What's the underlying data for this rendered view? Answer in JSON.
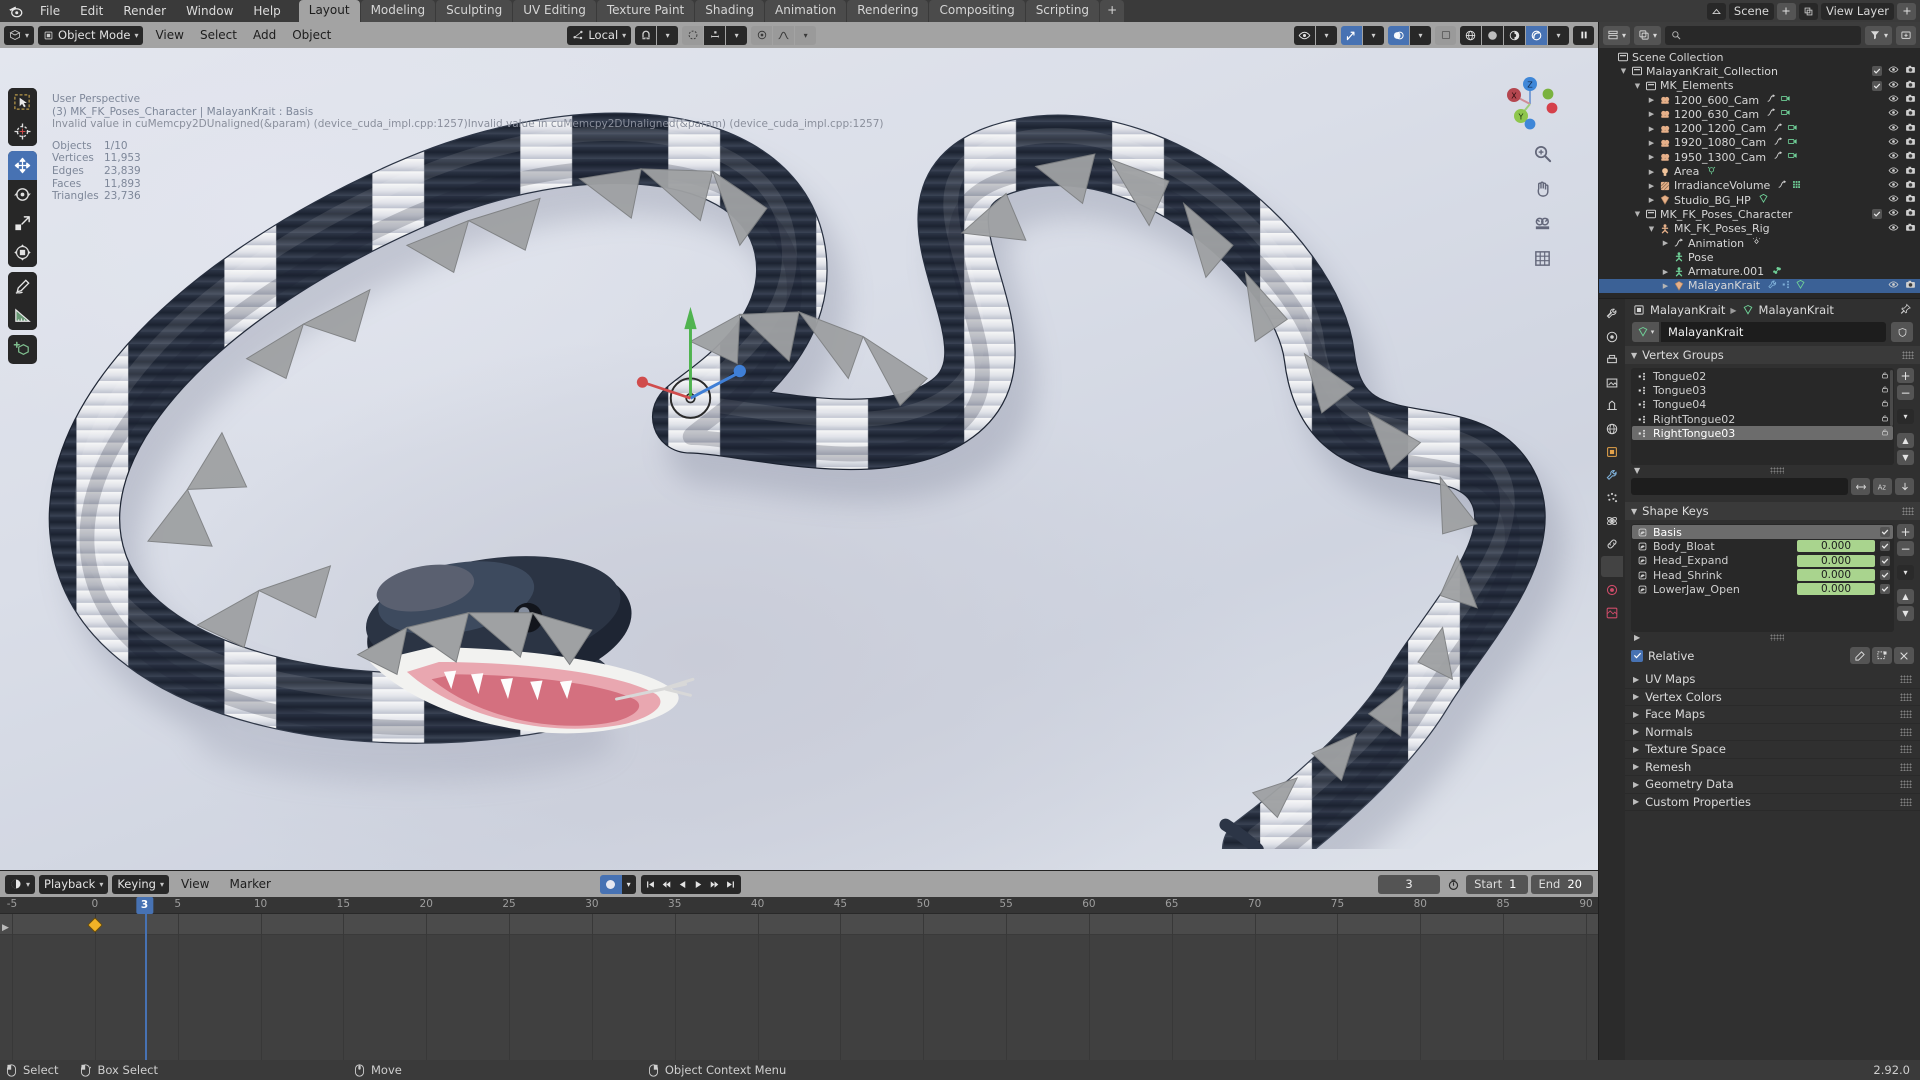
{
  "app": {
    "version": "2.92.0"
  },
  "topbar": {
    "logo_icon": "blender-logo-icon",
    "menus": [
      "File",
      "Edit",
      "Render",
      "Window",
      "Help"
    ],
    "workspaces": [
      {
        "label": "Layout",
        "active": true
      },
      {
        "label": "Modeling",
        "active": false
      },
      {
        "label": "Sculpting",
        "active": false
      },
      {
        "label": "UV Editing",
        "active": false
      },
      {
        "label": "Texture Paint",
        "active": false
      },
      {
        "label": "Shading",
        "active": false
      },
      {
        "label": "Animation",
        "active": false
      },
      {
        "label": "Rendering",
        "active": false
      },
      {
        "label": "Compositing",
        "active": false
      },
      {
        "label": "Scripting",
        "active": false
      }
    ],
    "add_workspace_label": "+",
    "scene_label": "Scene",
    "view_layer_label": "View Layer"
  },
  "viewport_header": {
    "mode": "Object Mode",
    "menus": [
      "View",
      "Select",
      "Add",
      "Object"
    ],
    "transform_orientation": "Local",
    "snap_icon": "magnet-icon",
    "proportional_icon": "proportional-edit-icon",
    "shading_modes": [
      "wireframe",
      "solid",
      "material-preview",
      "rendered"
    ],
    "active_shading": "rendered"
  },
  "viewport_overlay": {
    "perspective": "User Perspective",
    "context": "(3) MK_FK_Poses_Character | MalayanKrait : Basis",
    "error": "Invalid value in cuMemcpy2DUnaligned(&param) (device_cuda_impl.cpp:1257)Invalid value in cuMemcpy2DUnaligned(&param) (device_cuda_impl.cpp:1257)",
    "stats": [
      {
        "label": "Objects",
        "value": "1/10"
      },
      {
        "label": "Vertices",
        "value": "11,953"
      },
      {
        "label": "Edges",
        "value": "23,839"
      },
      {
        "label": "Faces",
        "value": "11,893"
      },
      {
        "label": "Triangles",
        "value": "23,736"
      }
    ],
    "gizmo_axes": [
      "X",
      "Y",
      "Z"
    ]
  },
  "toolbar": {
    "tools": [
      {
        "name": "tweak-tool",
        "icon": "cursor-arrow-icon",
        "active": false
      },
      {
        "name": "cursor-tool",
        "icon": "3d-cursor-icon",
        "active": false
      },
      {
        "name": "move-tool",
        "icon": "move-arrows-icon",
        "active": true
      },
      {
        "name": "rotate-tool",
        "icon": "rotate-icon",
        "active": false
      },
      {
        "name": "scale-tool",
        "icon": "scale-icon",
        "active": false
      },
      {
        "name": "transform-tool",
        "icon": "transform-icon",
        "active": false
      },
      {
        "name": "annotate-tool",
        "icon": "pencil-icon",
        "active": false
      },
      {
        "name": "measure-tool",
        "icon": "ruler-icon",
        "active": false
      },
      {
        "name": "add-cube-tool",
        "icon": "add-cube-icon",
        "active": false
      }
    ],
    "view_tools": [
      "zoom-icon",
      "pan-hand-icon",
      "camera-icon",
      "grid-icon"
    ]
  },
  "outliner": {
    "display_mode_icon": "view-layer-icon",
    "search_placeholder": "",
    "filter_icon": "funnel-icon",
    "rows": [
      {
        "indent": 0,
        "disclosure": "",
        "icon": "collection-icon",
        "name": "Scene Collection",
        "checkbox": false,
        "eye": false,
        "camera": false,
        "selected": false,
        "extras": []
      },
      {
        "indent": 1,
        "disclosure": "down",
        "icon": "collection-icon",
        "name": "MalayanKrait_Collection",
        "checkbox": true,
        "eye": true,
        "camera": true,
        "selected": false,
        "extras": []
      },
      {
        "indent": 2,
        "disclosure": "down",
        "icon": "collection-icon",
        "name": "MK_Elements",
        "checkbox": true,
        "eye": true,
        "camera": true,
        "selected": false,
        "extras": []
      },
      {
        "indent": 3,
        "disclosure": "right",
        "icon": "camera-obj-icon",
        "name": "1200_600_Cam",
        "checkbox": false,
        "eye": true,
        "camera": true,
        "selected": false,
        "extras": [
          "anim-curve-icon",
          "camera-data-icon"
        ]
      },
      {
        "indent": 3,
        "disclosure": "right",
        "icon": "camera-obj-icon",
        "name": "1200_630_Cam",
        "checkbox": false,
        "eye": true,
        "camera": true,
        "selected": false,
        "extras": [
          "anim-curve-icon",
          "camera-data-icon"
        ]
      },
      {
        "indent": 3,
        "disclosure": "right",
        "icon": "camera-obj-icon",
        "name": "1200_1200_Cam",
        "checkbox": false,
        "eye": true,
        "camera": true,
        "selected": false,
        "extras": [
          "anim-curve-icon",
          "camera-data-icon"
        ]
      },
      {
        "indent": 3,
        "disclosure": "right",
        "icon": "camera-obj-icon",
        "name": "1920_1080_Cam",
        "checkbox": false,
        "eye": true,
        "camera": true,
        "selected": false,
        "extras": [
          "anim-curve-icon",
          "camera-data-icon"
        ]
      },
      {
        "indent": 3,
        "disclosure": "right",
        "icon": "camera-obj-icon",
        "name": "1950_1300_Cam",
        "checkbox": false,
        "eye": true,
        "camera": true,
        "selected": false,
        "extras": [
          "anim-curve-icon",
          "camera-data-icon"
        ]
      },
      {
        "indent": 3,
        "disclosure": "right",
        "icon": "light-obj-icon",
        "name": "Area",
        "checkbox": false,
        "eye": true,
        "camera": true,
        "selected": false,
        "extras": [
          "light-data-icon"
        ]
      },
      {
        "indent": 3,
        "disclosure": "right",
        "icon": "irradiance-obj-icon",
        "name": "IrradianceVolume",
        "checkbox": false,
        "eye": true,
        "camera": true,
        "selected": false,
        "extras": [
          "anim-curve-icon",
          "irradiance-grid-icon"
        ]
      },
      {
        "indent": 3,
        "disclosure": "right",
        "icon": "mesh-obj-icon",
        "name": "Studio_BG_HP",
        "checkbox": false,
        "eye": true,
        "camera": true,
        "selected": false,
        "extras": [
          "mesh-data-icon"
        ]
      },
      {
        "indent": 2,
        "disclosure": "down",
        "icon": "collection-icon",
        "name": "MK_FK_Poses_Character",
        "checkbox": true,
        "eye": true,
        "camera": true,
        "selected": false,
        "extras": []
      },
      {
        "indent": 3,
        "disclosure": "down",
        "icon": "armature-obj-icon",
        "name": "MK_FK_Poses_Rig",
        "checkbox": false,
        "eye": true,
        "camera": true,
        "selected": false,
        "extras": []
      },
      {
        "indent": 4,
        "disclosure": "right",
        "icon": "anim-curve-icon",
        "name": "Animation",
        "checkbox": false,
        "eye": false,
        "camera": false,
        "selected": false,
        "extras": [
          "keyframe-icon"
        ]
      },
      {
        "indent": 4,
        "disclosure": "",
        "icon": "pose-icon",
        "name": "Pose",
        "checkbox": false,
        "eye": false,
        "camera": false,
        "selected": false,
        "extras": []
      },
      {
        "indent": 4,
        "disclosure": "right",
        "icon": "pose-icon",
        "name": "Armature.001",
        "checkbox": false,
        "eye": false,
        "camera": false,
        "selected": false,
        "extras": [
          "bone-icon"
        ]
      },
      {
        "indent": 4,
        "disclosure": "right",
        "icon": "mesh-obj-icon",
        "name": "MalayanKrait",
        "checkbox": false,
        "eye": true,
        "camera": true,
        "selected": true,
        "extras": [
          "modifier-icon",
          "vertexgroup-icon",
          "mesh-data-icon"
        ]
      }
    ]
  },
  "properties": {
    "tabs": [
      {
        "name": "tool",
        "icon": "tool-icon",
        "active": false
      },
      {
        "name": "render",
        "icon": "render-icon",
        "active": false
      },
      {
        "name": "output",
        "icon": "printer-icon",
        "active": false
      },
      {
        "name": "view-layer",
        "icon": "images-icon",
        "active": false
      },
      {
        "name": "scene",
        "icon": "scene-icon",
        "active": false
      },
      {
        "name": "world",
        "icon": "world-icon",
        "active": false
      },
      {
        "name": "object",
        "icon": "object-icon",
        "active": false
      },
      {
        "name": "modifier",
        "icon": "wrench-icon",
        "active": false
      },
      {
        "name": "particles",
        "icon": "particles-icon",
        "active": false
      },
      {
        "name": "physics",
        "icon": "physics-icon",
        "active": false
      },
      {
        "name": "constraint",
        "icon": "constraint-icon",
        "active": false
      },
      {
        "name": "data",
        "icon": "mesh-data-icon",
        "active": true
      },
      {
        "name": "material",
        "icon": "material-icon",
        "active": false
      },
      {
        "name": "texture",
        "icon": "texture-icon",
        "active": false
      }
    ],
    "breadcrumb": [
      "MalayanKrait",
      "MalayanKrait"
    ],
    "id_name": "MalayanKrait",
    "vertex_groups": {
      "title": "Vertex Groups",
      "items": [
        {
          "name": "Tongue02",
          "selected": false
        },
        {
          "name": "Tongue03",
          "selected": false
        },
        {
          "name": "Tongue04",
          "selected": false
        },
        {
          "name": "RightTongue02",
          "selected": false
        },
        {
          "name": "RightTongue03",
          "selected": true
        }
      ],
      "buttons": [
        "+",
        "−",
        "chevron-down",
        "up-arrow",
        "down-arrow"
      ],
      "name_field_value": ""
    },
    "shape_keys": {
      "title": "Shape Keys",
      "items": [
        {
          "name": "Basis",
          "value": "",
          "selected": true,
          "enabled": true
        },
        {
          "name": "Body_Bloat",
          "value": "0.000",
          "selected": false,
          "enabled": true
        },
        {
          "name": "Head_Expand",
          "value": "0.000",
          "selected": false,
          "enabled": true
        },
        {
          "name": "Head_Shrink",
          "value": "0.000",
          "selected": false,
          "enabled": true
        },
        {
          "name": "LowerJaw_Open",
          "value": "0.000",
          "selected": false,
          "enabled": true
        }
      ],
      "buttons": [
        "+",
        "−",
        "chevron-down",
        "up-arrow",
        "down-arrow"
      ],
      "relative_label": "Relative",
      "relative_checked": true,
      "value_color": "#a9d48e"
    },
    "closed_panels": [
      "UV Maps",
      "Vertex Colors",
      "Face Maps",
      "Normals",
      "Texture Space",
      "Remesh",
      "Geometry Data",
      "Custom Properties"
    ]
  },
  "timeline": {
    "editor_icon": "timeline-icon",
    "menus": [
      "Playback",
      "Keying",
      "View",
      "Marker"
    ],
    "record_icon": "auto-keying-icon",
    "transport": [
      "jump-start-icon",
      "prev-keyframe-icon",
      "play-reverse-icon",
      "play-icon",
      "next-keyframe-icon",
      "jump-end-icon"
    ],
    "current_frame": "3",
    "start_label": "Start",
    "start_value": "1",
    "end_label": "End",
    "end_value": "20",
    "ruler_ticks": [
      "-5",
      "0",
      "5",
      "10",
      "15",
      "20",
      "25",
      "30",
      "35",
      "40",
      "45",
      "50",
      "55",
      "60",
      "65",
      "70",
      "75",
      "80",
      "85",
      "90"
    ],
    "keyframes": [
      0
    ]
  },
  "statusbar": {
    "items": [
      {
        "icon": "mouse-left-icon",
        "label": "Select"
      },
      {
        "icon": "mouse-left-drag-icon",
        "label": "Box Select"
      },
      {
        "icon": "mouse-middle-icon",
        "label": "Move"
      },
      {
        "icon": "mouse-right-icon",
        "label": "Object Context Menu"
      }
    ],
    "version": "2.92.0"
  },
  "colors": {
    "accent_blue": "#4772b3",
    "header_gray": "#a3a3a3",
    "panel_bg": "#303030",
    "outliner_bg": "#282828",
    "value_green": "#a9d48e",
    "keyframe_yellow": "#f0b227"
  }
}
